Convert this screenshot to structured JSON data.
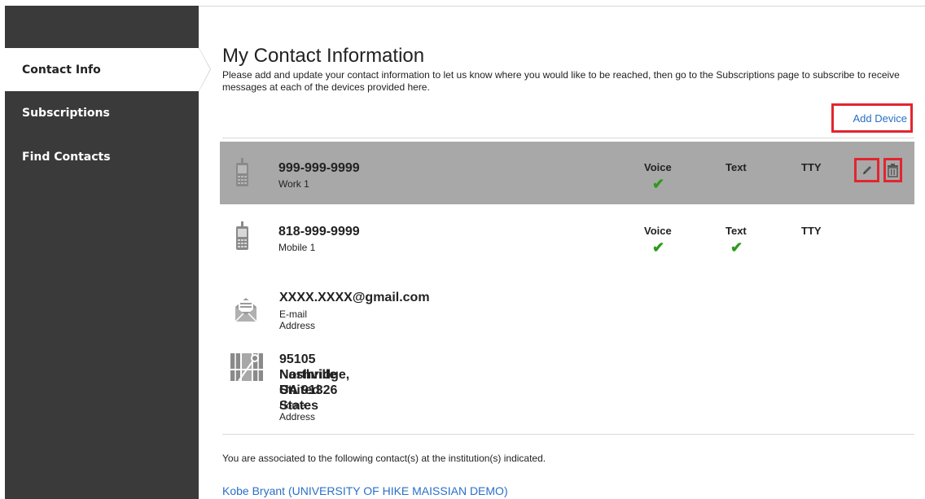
{
  "sidebar": {
    "items": [
      {
        "label": "Contact Info",
        "active": true
      },
      {
        "label": "Subscriptions",
        "active": false
      },
      {
        "label": "Find Contacts",
        "active": false
      }
    ]
  },
  "header": {
    "title": "My Contact Information",
    "description": "Please add and update your contact information to let us know where you would like to be reached, then go to the Subscriptions page to subscribe to receive messages at each of the devices provided here.",
    "add_device_label": "Add Device"
  },
  "columns": {
    "voice": "Voice",
    "text": "Text",
    "tty": "TTY"
  },
  "devices": [
    {
      "number": "999-999-9999",
      "label": "Work 1",
      "voice": true,
      "text": false,
      "tty": false,
      "selected": true
    },
    {
      "number": "818-999-9999",
      "label": "Mobile 1",
      "voice": true,
      "text": true,
      "tty": false,
      "selected": false
    }
  ],
  "email": {
    "value": "XXXX.XXXX@gmail.com",
    "label": "E-mail Address"
  },
  "address": {
    "line1": "95105 Nashville St.",
    "line2": "Northridge, CA 91326",
    "line3": "United States",
    "label": "Home Address"
  },
  "association": {
    "text": "You are associated to the following contact(s) at the institution(s) indicated.",
    "link": "Kobe Bryant (UNIVERSITY OF HIKE MAISSIAN DEMO)"
  },
  "icons": {
    "check": "✔"
  },
  "colors": {
    "sidebar_bg": "#3a3a3a",
    "selected_row_bg": "#a8a8a8",
    "highlight_border": "#e2252f",
    "link": "#2a6fc9",
    "check": "#2d9b1c"
  }
}
